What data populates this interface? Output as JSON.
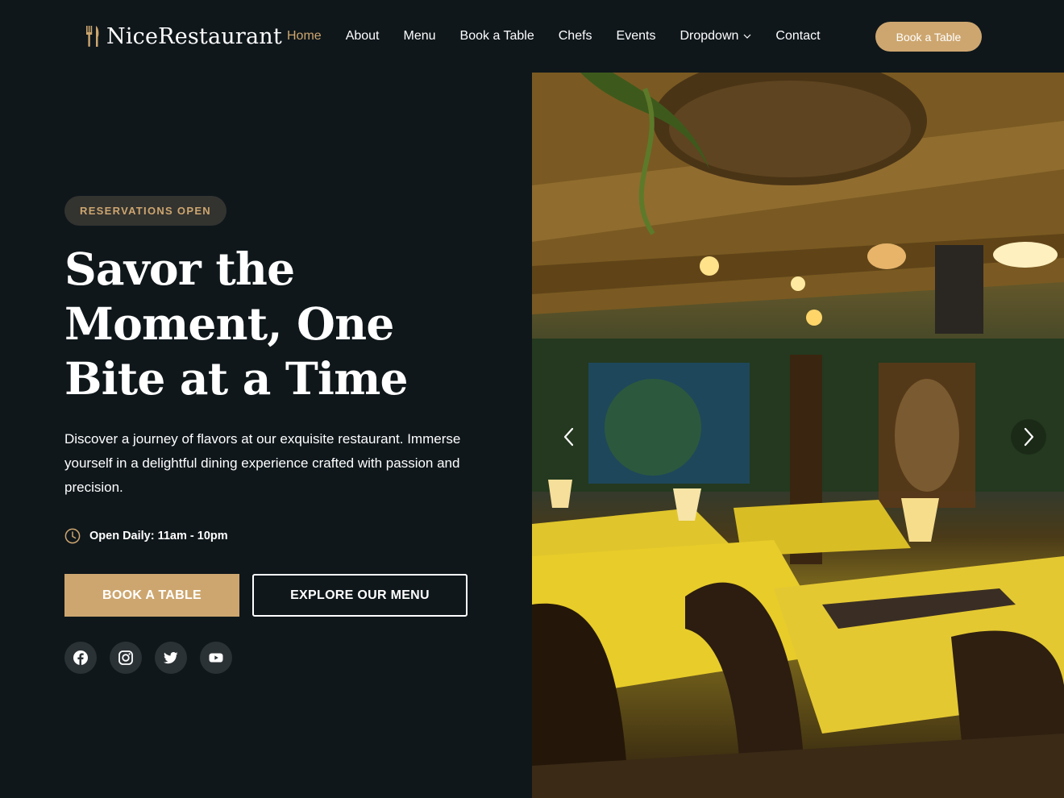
{
  "brand": {
    "name": "NiceRestaurant",
    "accent_color": "#cda66f",
    "background_color": "#0f171b"
  },
  "nav": {
    "items": [
      {
        "label": "Home",
        "active": true
      },
      {
        "label": "About"
      },
      {
        "label": "Menu"
      },
      {
        "label": "Book a Table"
      },
      {
        "label": "Chefs"
      },
      {
        "label": "Events"
      },
      {
        "label": "Dropdown",
        "icon": "chevron-down-icon"
      },
      {
        "label": "Contact"
      }
    ],
    "cta_label": "Book a Table"
  },
  "hero": {
    "badge": "RESERVATIONS OPEN",
    "headline_lines": [
      "Savor the",
      "Moment, One",
      "Bite at a Time"
    ],
    "lead": "Discover a journey of flavors at our exquisite restaurant. Immerse yourself in a delightful dining experience crafted with passion and precision.",
    "hours": "Open Daily: 11am - 10pm",
    "hours_icon": "clock-icon",
    "primary_button": "BOOK A TABLE",
    "secondary_button": "EXPLORE OUR MENU",
    "socials": [
      "facebook-icon",
      "instagram-icon",
      "twitter-icon",
      "youtube-icon"
    ]
  },
  "carousel": {
    "prev_icon": "chevron-left-icon",
    "next_icon": "chevron-right-icon"
  }
}
